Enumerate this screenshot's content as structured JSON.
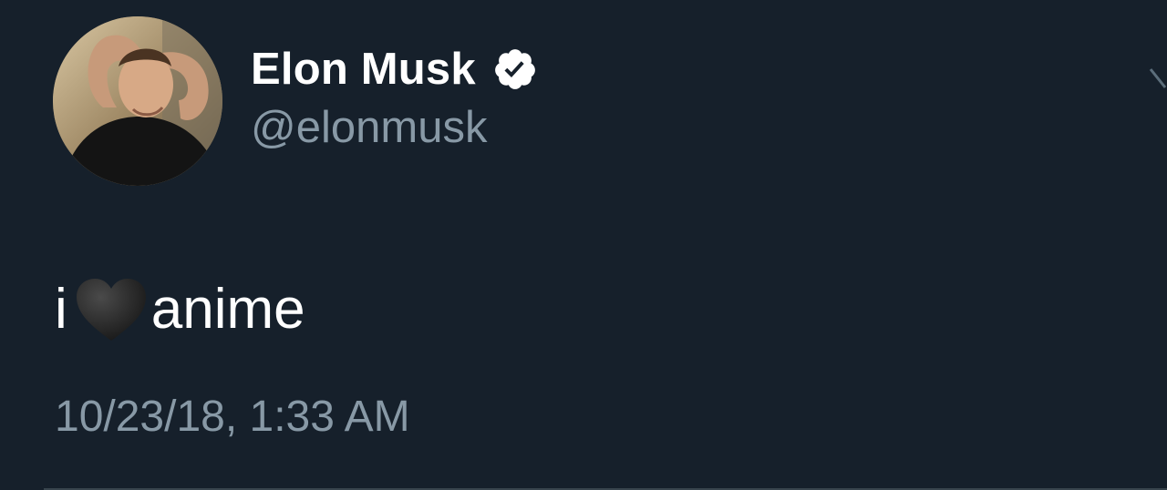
{
  "tweet": {
    "author": {
      "display_name": "Elon Musk",
      "handle": "@elonmusk",
      "verified": true
    },
    "text_before_emoji": "i",
    "emoji": "black-heart-icon",
    "text_after_emoji": "anime",
    "timestamp": "10/23/18, 1:33 AM"
  },
  "colors": {
    "background": "#16202b",
    "primary_text": "#ffffff",
    "secondary_text": "#8899a6",
    "divider": "#38444d"
  }
}
